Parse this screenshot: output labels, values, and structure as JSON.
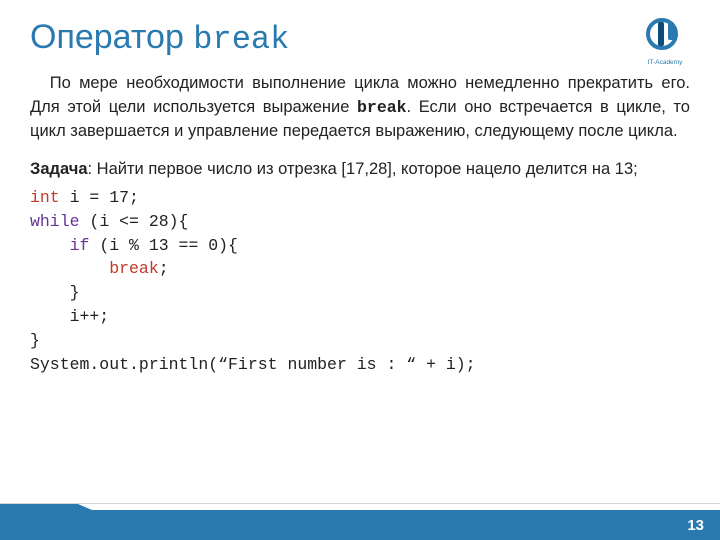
{
  "title": {
    "main": "Оператор  ",
    "mono": "break"
  },
  "logo": {
    "caption": "IT-Academy"
  },
  "paragraph": {
    "p1_pre": "По мере необходимости выполнение цикла можно немедленно прекратить его. Для этой цели используется выражение ",
    "p1_break": "break",
    "p1_post": ". Если оно встречается в цикле, то цикл завершается и управление передается выражению, следующему после цикла."
  },
  "task": {
    "label": "Задача",
    "text": ": Найти первое число из отрезка [17,28], которое нацело делится на 13;"
  },
  "code": {
    "l1_kw": "int",
    "l1_rest": " i = 17;",
    "l2_kw": "while",
    "l2_rest": " (i <= 28){",
    "l3_pad": "    ",
    "l3_kw": "if",
    "l3_rest": " (i % 13 == 0){",
    "l4_pad": "        ",
    "l4_kw": "break",
    "l4_rest": ";",
    "l5": "    }",
    "l6": "    i++;",
    "l7": "}",
    "l8": "System.out.println(“First number is : “ + i);"
  },
  "page": "13"
}
